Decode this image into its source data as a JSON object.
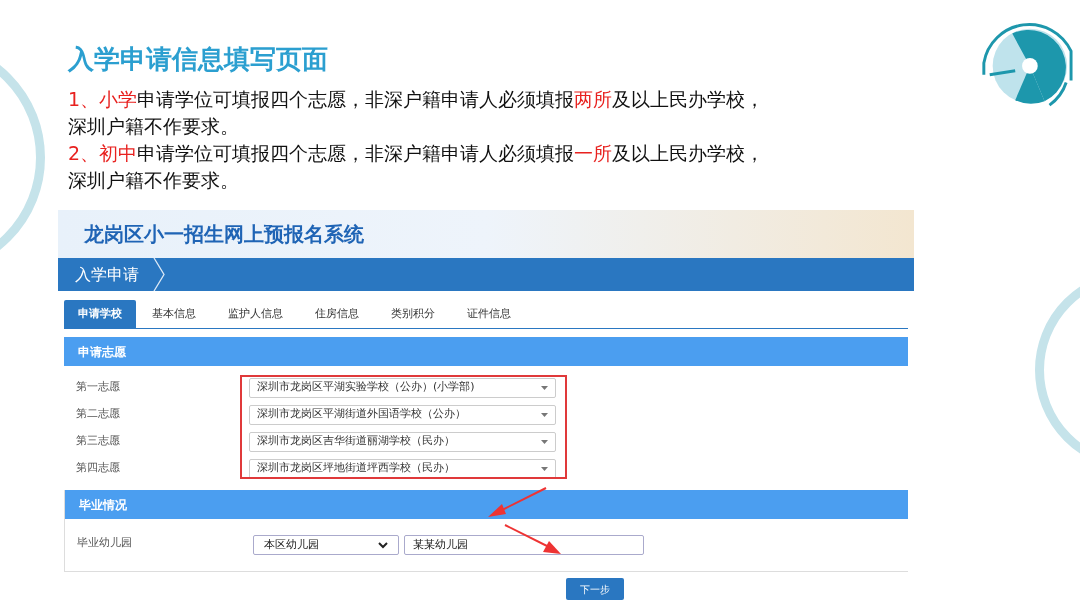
{
  "slide": {
    "title": "入学申请信息填写页面",
    "paragraphs": [
      {
        "segments": [
          {
            "text": "1、小学",
            "highlight": true
          },
          {
            "text": "申请学位可填报四个志愿，非深户籍申请人必须填报",
            "highlight": false
          },
          {
            "text": "两所",
            "highlight": true
          },
          {
            "text": "及以上民办学校，深圳户籍不作要求。",
            "highlight": false
          }
        ]
      },
      {
        "segments": [
          {
            "text": "2、初中",
            "highlight": true
          },
          {
            "text": "申请学位可填报四个志愿，非深户籍申请人必须填报",
            "highlight": false
          },
          {
            "text": "一所",
            "highlight": true
          },
          {
            "text": "及以上民办学校，深圳户籍不作要求。",
            "highlight": false
          }
        ]
      }
    ]
  },
  "app": {
    "system_title": "龙岗区小一招生网上预报名系统",
    "breadcrumb": "入学申请",
    "tabs": [
      {
        "label": "申请学校",
        "selected": true
      },
      {
        "label": "基本信息",
        "selected": false
      },
      {
        "label": "监护人信息",
        "selected": false
      },
      {
        "label": "住房信息",
        "selected": false
      },
      {
        "label": "类别积分",
        "selected": false
      },
      {
        "label": "证件信息",
        "selected": false
      }
    ],
    "sections": [
      {
        "title": "申请志愿",
        "highlighted": true,
        "rows": [
          {
            "label": "第一志愿",
            "kind": "select",
            "value": "深圳市龙岗区平湖实验学校（公办）(小学部)"
          },
          {
            "label": "第二志愿",
            "kind": "select",
            "value": "深圳市龙岗区平湖街道外国语学校（公办）"
          },
          {
            "label": "第三志愿",
            "kind": "select",
            "value": "深圳市龙岗区吉华街道丽湖学校（民办）"
          },
          {
            "label": "第四志愿",
            "kind": "select",
            "value": "深圳市龙岗区坪地街道坪西学校（民办）"
          }
        ]
      },
      {
        "title": "毕业情况",
        "highlighted": false,
        "rows": [
          {
            "label": "毕业幼儿园",
            "kind": "select-input",
            "select_value": "本区幼儿园",
            "input_value": "某某幼儿园"
          }
        ]
      }
    ],
    "next_button": "下一步"
  }
}
